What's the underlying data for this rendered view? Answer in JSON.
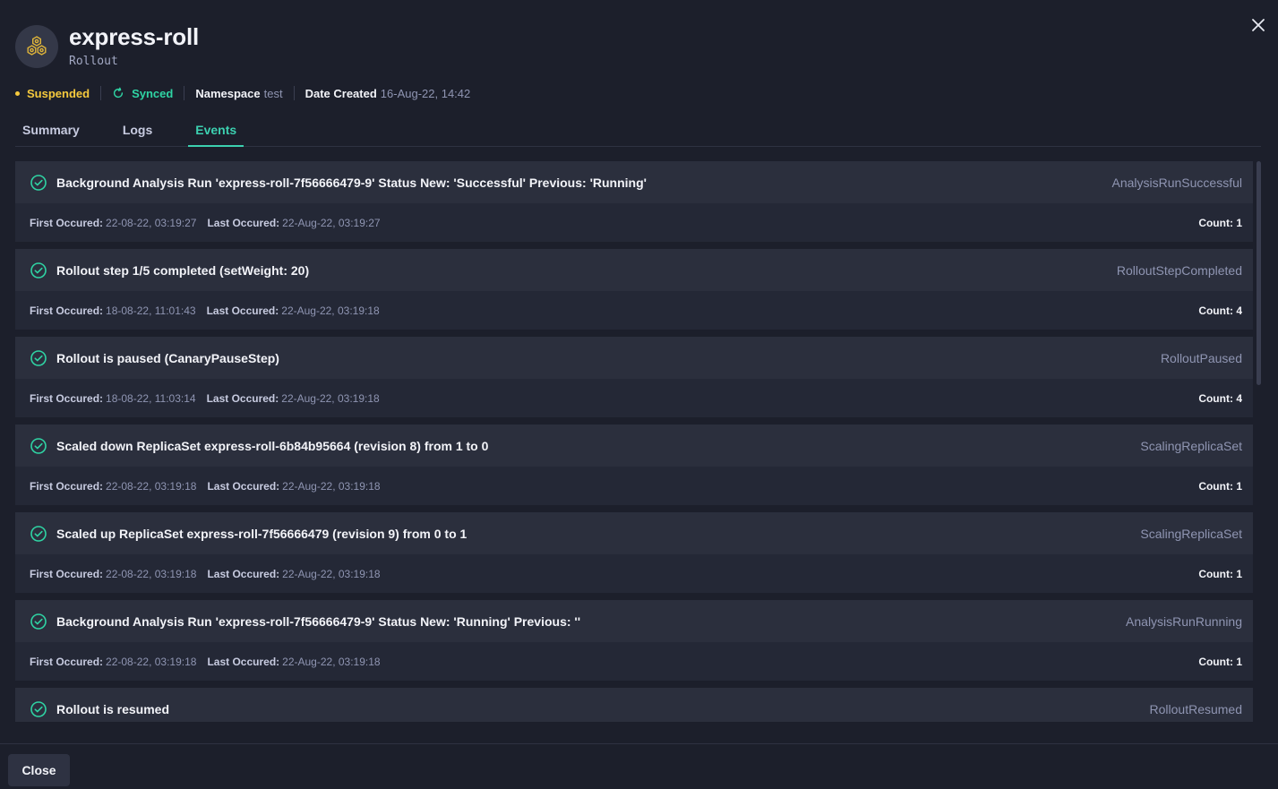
{
  "header": {
    "title": "express-roll",
    "subtitle": "Rollout",
    "icon": "rollout-hexagon-icon"
  },
  "meta": {
    "status": "Suspended",
    "sync": "Synced",
    "namespace_label": "Namespace",
    "namespace_value": "test",
    "date_label": "Date Created",
    "date_value": "16-Aug-22, 14:42"
  },
  "tabs": [
    {
      "label": "Summary",
      "active": false
    },
    {
      "label": "Logs",
      "active": false
    },
    {
      "label": "Events",
      "active": true
    }
  ],
  "events": {
    "first_label": "First Occured:",
    "last_label": "Last Occured:",
    "count_label": "Count:",
    "items": [
      {
        "message": "Background Analysis Run 'express-roll-7f56666479-9' Status New: 'Successful' Previous: 'Running'",
        "reason": "AnalysisRunSuccessful",
        "first": "22-08-22, 03:19:27",
        "last": "22-Aug-22, 03:19:27",
        "count": "1"
      },
      {
        "message": "Rollout step 1/5 completed (setWeight: 20)",
        "reason": "RolloutStepCompleted",
        "first": "18-08-22, 11:01:43",
        "last": "22-Aug-22, 03:19:18",
        "count": "4"
      },
      {
        "message": "Rollout is paused (CanaryPauseStep)",
        "reason": "RolloutPaused",
        "first": "18-08-22, 11:03:14",
        "last": "22-Aug-22, 03:19:18",
        "count": "4"
      },
      {
        "message": "Scaled down ReplicaSet express-roll-6b84b95664 (revision 8) from 1 to 0",
        "reason": "ScalingReplicaSet",
        "first": "22-08-22, 03:19:18",
        "last": "22-Aug-22, 03:19:18",
        "count": "1"
      },
      {
        "message": "Scaled up ReplicaSet express-roll-7f56666479 (revision 9) from 0 to 1",
        "reason": "ScalingReplicaSet",
        "first": "22-08-22, 03:19:18",
        "last": "22-Aug-22, 03:19:18",
        "count": "1"
      },
      {
        "message": "Background Analysis Run 'express-roll-7f56666479-9' Status New: 'Running' Previous: ''",
        "reason": "AnalysisRunRunning",
        "first": "22-08-22, 03:19:18",
        "last": "22-Aug-22, 03:19:18",
        "count": "1"
      },
      {
        "message": "Rollout is resumed",
        "reason": "RolloutResumed"
      }
    ]
  },
  "footer": {
    "close_label": "Close"
  },
  "colors": {
    "accent": "#3cd0b0",
    "suspended": "#f5c93d",
    "synced": "#2fd4a4",
    "background": "#1c1f2b"
  }
}
